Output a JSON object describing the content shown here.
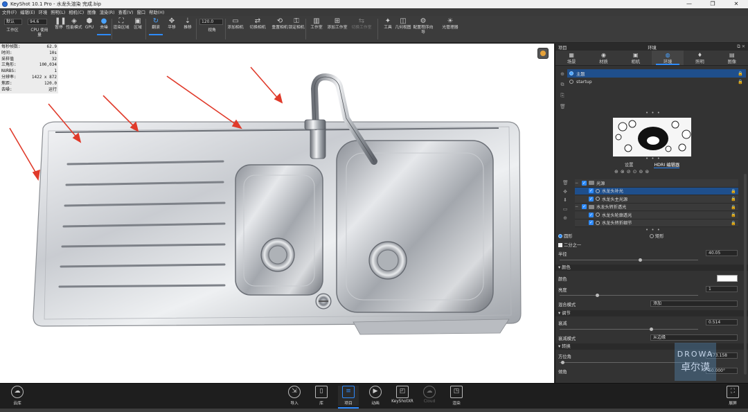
{
  "title_bar": {
    "title": "KeyShot 10.1 Pro  - 水龙头渲染 完成.bip",
    "min": "—",
    "max": "❐",
    "close": "✕"
  },
  "menu": [
    "文件(F)",
    "编辑(E)",
    "环境",
    "照明(L)",
    "相机(C)",
    "图像",
    "渲染(R)",
    "查看(V)",
    "窗口",
    "帮助(H)"
  ],
  "toolbar": {
    "preset_value": "默认",
    "zoom_value": "94.6",
    "fov_value": "120.0",
    "items": [
      {
        "label": "工作区",
        "icon": "▤"
      },
      {
        "label": "CPU 使用量",
        "icon": "▦"
      },
      {
        "label": "暂停",
        "icon": "❚❚"
      },
      {
        "label": "性能模式",
        "icon": "◈"
      },
      {
        "label": "GPU",
        "icon": "⬢"
      },
      {
        "label": "去噪",
        "icon": "●"
      },
      {
        "label": "渲染区域",
        "icon": "⛶"
      },
      {
        "label": "区域",
        "icon": "▣"
      },
      {
        "label": "翻滚",
        "icon": "↻"
      },
      {
        "label": "平移",
        "icon": "✥"
      },
      {
        "label": "推移",
        "icon": "⇣"
      },
      {
        "label": "视角",
        "icon": ""
      },
      {
        "label": "添加相机",
        "icon": "▭"
      },
      {
        "label": "切换相机",
        "icon": "⇄"
      },
      {
        "label": "重置相机",
        "icon": "⟲"
      },
      {
        "label": "锁定相机",
        "icon": "⚿"
      },
      {
        "label": "工作室",
        "icon": "▥"
      },
      {
        "label": "添加工作室",
        "icon": "⊞"
      },
      {
        "label": "切换工作室",
        "icon": "⇆"
      },
      {
        "label": "工具",
        "icon": "✦"
      },
      {
        "label": "几何视图",
        "icon": "◫"
      },
      {
        "label": "配置程序向导",
        "icon": "⚙"
      },
      {
        "label": "光管理器",
        "icon": "☀"
      }
    ]
  },
  "hud": {
    "rows": [
      {
        "k": "每秒帧数:",
        "v": "62.9"
      },
      {
        "k": "时间:",
        "v": "10s"
      },
      {
        "k": "采样值",
        "v": "32"
      },
      {
        "k": "三角形:",
        "v": "100,034"
      },
      {
        "k": "NURBS:",
        "v": "1"
      },
      {
        "k": "分辨率:",
        "v": "1422 x 872"
      },
      {
        "k": "焦距:",
        "v": "120.0"
      },
      {
        "k": "去噪:",
        "v": "运行"
      }
    ]
  },
  "panel": {
    "left_title": "项目",
    "title": "环境",
    "header_icons": "⧉ ✕",
    "tabs": [
      {
        "label": "场景",
        "icon": "▦"
      },
      {
        "label": "材质",
        "icon": "◉"
      },
      {
        "label": "相机",
        "icon": "▣"
      },
      {
        "label": "环境",
        "icon": "◍"
      },
      {
        "label": "照明",
        "icon": "♦"
      },
      {
        "label": "图像",
        "icon": "▤"
      }
    ],
    "env_list": [
      {
        "name": "主题",
        "lock": "🔒"
      },
      {
        "name": "startup",
        "lock": "🔒"
      }
    ],
    "more_dots": "• • •",
    "subtabs": [
      "设置",
      "HDRI 编辑器"
    ],
    "tool_icons": [
      "⊕",
      "⊗",
      "⊘",
      "⊙",
      "⊚",
      "⊛"
    ],
    "tree": [
      {
        "name": "光源",
        "type": "folder"
      },
      {
        "name": "水龙头补光",
        "type": "item"
      },
      {
        "name": "水龙头主光源",
        "type": "item"
      },
      {
        "name": "水龙头转折透光",
        "type": "folder"
      },
      {
        "name": "水龙头轮廓透光",
        "type": "item"
      },
      {
        "name": "水龙头转折细节",
        "type": "item"
      }
    ],
    "shape": {
      "circle_label": "圆形",
      "rect_label": "矩形",
      "half_label": "二分之一"
    },
    "radius": {
      "label": "半径",
      "value": "40.05"
    },
    "color_section": {
      "title": "颜色",
      "color_label": "颜色",
      "brightness_label": "亮度",
      "brightness_value": "1",
      "blend_label": "混合模式",
      "blend_value": "添加"
    },
    "adjust_section": {
      "title": "调节",
      "falloff_label": "衰减",
      "falloff_value": "0.514",
      "falloff_mode_label": "衰减模式",
      "falloff_mode_value": "从边缘"
    },
    "transform_section": {
      "title": "转换",
      "azimuth_label": "方位角",
      "azimuth_value": "-173.158",
      "tilt_label": "倾角",
      "tilt_value": "60.000°"
    }
  },
  "watermark": {
    "line1": "DROWA",
    "line2": "卓尔谟"
  },
  "bottom": {
    "items": [
      {
        "label": "云库",
        "icon": "☁"
      },
      {
        "label": "导入",
        "icon": "⇲"
      },
      {
        "label": "库",
        "icon": "▯"
      },
      {
        "label": "项目",
        "icon": "≡"
      },
      {
        "label": "动画",
        "icon": "▶"
      },
      {
        "label": "KeyShotXR",
        "icon": "◰"
      },
      {
        "label": "Cloud",
        "icon": "☁"
      },
      {
        "label": "渲染",
        "icon": "◳"
      },
      {
        "label": "展屏",
        "icon": "⛶"
      }
    ]
  },
  "colors": {
    "accent": "#2e8bff",
    "selection": "#1f4f8c",
    "arrow": "#e03a2a"
  }
}
